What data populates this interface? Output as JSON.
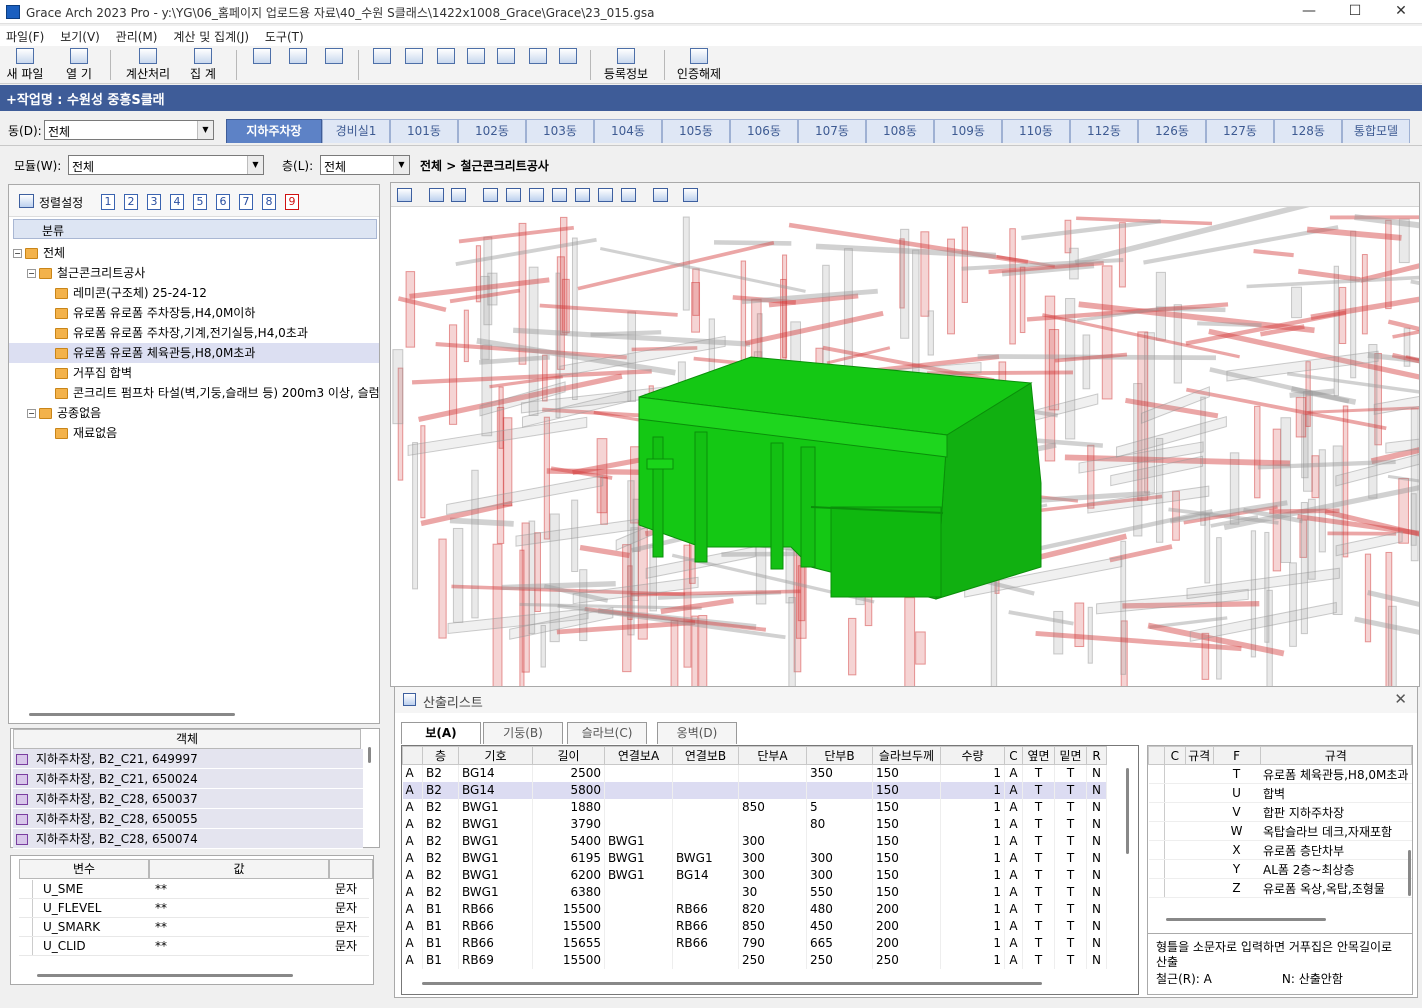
{
  "window": {
    "title": "Grace Arch 2023 Pro - y:\\YG\\06_홈페이지 업로드용 자료\\40_수원 S클래스\\1422x1008_Grace\\Grace\\23_015.gsa"
  },
  "menu": [
    "파일(F)",
    "보기(V)",
    "관리(M)",
    "계산 및 집계(J)",
    "도구(T)"
  ],
  "toolbar": {
    "new": "새 파일",
    "open": "열 기",
    "calc": "계산처리",
    "sum": "집 계",
    "reg": "등록정보",
    "cert": "인증해제"
  },
  "work": {
    "label": "+작업명 : 수원성 중흥S클래"
  },
  "dong": {
    "label": "동(D):",
    "value": "전체",
    "tabs": [
      "지하주차장",
      "경비실1",
      "101동",
      "102동",
      "103동",
      "104동",
      "105동",
      "106동",
      "107동",
      "108동",
      "109동",
      "110동",
      "112동",
      "126동",
      "127동",
      "128동",
      "통합모델"
    ]
  },
  "filter": {
    "module_label": "모듈(W):",
    "module_value": "전체",
    "floor_label": "층(L):",
    "floor_value": "전체",
    "path": "전체 > 철근콘크리트공사"
  },
  "sort": {
    "label": "정렬설정",
    "numbers": [
      "1",
      "2",
      "3",
      "4",
      "5",
      "6",
      "7",
      "8",
      "9"
    ]
  },
  "tree": {
    "header": "분류",
    "rows": [
      {
        "text": "전체",
        "level": 0,
        "exp": "−"
      },
      {
        "text": "철근콘크리트공사",
        "level": 1,
        "exp": "−"
      },
      {
        "text": "레미콘(구조체)  25-24-12",
        "level": 2,
        "exp": ""
      },
      {
        "text": "유로폼  유로폼 주차장등,H4,0M이하",
        "level": 2,
        "exp": ""
      },
      {
        "text": "유로폼  유로폼 주차장,기계,전기실등,H4,0초과",
        "level": 2,
        "exp": ""
      },
      {
        "text": "유로폼  유로폼 체육관등,H8,0M초과",
        "level": 2,
        "exp": ""
      },
      {
        "text": "거푸집  합벽",
        "level": 2,
        "exp": ""
      },
      {
        "text": "콘크리트 펌프차 타설(벽,기둥,슬래브 등)  200m3 이상, 슬럼",
        "level": 2,
        "exp": ""
      },
      {
        "text": "공종없음",
        "level": 1,
        "exp": "−"
      },
      {
        "text": "재료없음",
        "level": 2,
        "exp": ""
      }
    ]
  },
  "objects": {
    "header": "객체",
    "rows": [
      "지하주차장, B2_C21, 649997",
      "지하주차장, B2_C21, 650024",
      "지하주차장, B2_C28, 650037",
      "지하주차장, B2_C28, 650055",
      "지하주차장, B2_C28, 650074"
    ]
  },
  "vars": {
    "col_var": "변수",
    "col_val": "값",
    "rows": [
      {
        "name": "U_SME",
        "value": "**",
        "type": "문자"
      },
      {
        "name": "U_FLEVEL",
        "value": "**",
        "type": "문자"
      },
      {
        "name": "U_SMARK",
        "value": "**",
        "type": "문자"
      },
      {
        "name": "U_CLID",
        "value": "**",
        "type": "문자"
      }
    ]
  },
  "list": {
    "title": "산출리스트",
    "tabs": [
      "보(A)",
      "기둥(B)",
      "슬라브(C)",
      "옹벽(D)"
    ],
    "columns": [
      "",
      "층",
      "기호",
      "길이",
      "연결보A",
      "연결보B",
      "단부A",
      "단부B",
      "슬라브두께",
      "수량",
      "C",
      "옆면",
      "밑면",
      "R"
    ],
    "rows": [
      [
        "A",
        "B2",
        "BG14",
        "2500",
        "",
        "",
        "",
        "350",
        "150",
        "1",
        "A",
        "T",
        "T",
        "N"
      ],
      [
        "A",
        "B2",
        "BG14",
        "5800",
        "",
        "",
        "",
        "",
        "150",
        "1",
        "A",
        "T",
        "T",
        "N"
      ],
      [
        "A",
        "B2",
        "BWG1",
        "1880",
        "",
        "",
        "850",
        "5",
        "150",
        "1",
        "A",
        "T",
        "T",
        "N"
      ],
      [
        "A",
        "B2",
        "BWG1",
        "3790",
        "",
        "",
        "",
        "80",
        "150",
        "1",
        "A",
        "T",
        "T",
        "N"
      ],
      [
        "A",
        "B2",
        "BWG1",
        "5400",
        "BWG1",
        "",
        "300",
        "",
        "150",
        "1",
        "A",
        "T",
        "T",
        "N"
      ],
      [
        "A",
        "B2",
        "BWG1",
        "6195",
        "BWG1",
        "BWG1",
        "300",
        "300",
        "150",
        "1",
        "A",
        "T",
        "T",
        "N"
      ],
      [
        "A",
        "B2",
        "BWG1",
        "6200",
        "BWG1",
        "BG14",
        "300",
        "300",
        "150",
        "1",
        "A",
        "T",
        "T",
        "N"
      ],
      [
        "A",
        "B2",
        "BWG1",
        "6380",
        "",
        "",
        "30",
        "550",
        "150",
        "1",
        "A",
        "T",
        "T",
        "N"
      ],
      [
        "A",
        "B1",
        "RB66",
        "15500",
        "",
        "RB66",
        "820",
        "480",
        "200",
        "1",
        "A",
        "T",
        "T",
        "N"
      ],
      [
        "A",
        "B1",
        "RB66",
        "15500",
        "",
        "RB66",
        "850",
        "450",
        "200",
        "1",
        "A",
        "T",
        "T",
        "N"
      ],
      [
        "A",
        "B1",
        "RB66",
        "15655",
        "",
        "RB66",
        "790",
        "665",
        "200",
        "1",
        "A",
        "T",
        "T",
        "N"
      ],
      [
        "A",
        "B1",
        "RB69",
        "15500",
        "",
        "",
        "250",
        "250",
        "250",
        "1",
        "A",
        "T",
        "T",
        "N"
      ]
    ],
    "selected_row": 1
  },
  "codes": {
    "columns": [
      "C",
      "규격",
      "F",
      "규격"
    ],
    "rows": [
      {
        "f": "T",
        "spec": "유로폼 체육관등,H8,0M초과"
      },
      {
        "f": "U",
        "spec": "합벽"
      },
      {
        "f": "V",
        "spec": "합판 지하주차장"
      },
      {
        "f": "W",
        "spec": "옥탑슬라브 데크,자재포함"
      },
      {
        "f": "X",
        "spec": "유로폼 층단차부"
      },
      {
        "f": "Y",
        "spec": "AL폼 2층~최상층"
      },
      {
        "f": "Z",
        "spec": "유로폼 옥상,옥탑,조형물"
      }
    ]
  },
  "hint": {
    "line1": "형틀을 소문자로 입력하면 거푸집은 안목길이로 산출",
    "line2a": "철근(R): A",
    "line2b": "N: 산출안함"
  },
  "colors": {
    "highlight": "#14c814",
    "ghost_red": "#d23a3a",
    "ghost_gray": "#9a9a9a",
    "accent": "#3e5c98"
  }
}
